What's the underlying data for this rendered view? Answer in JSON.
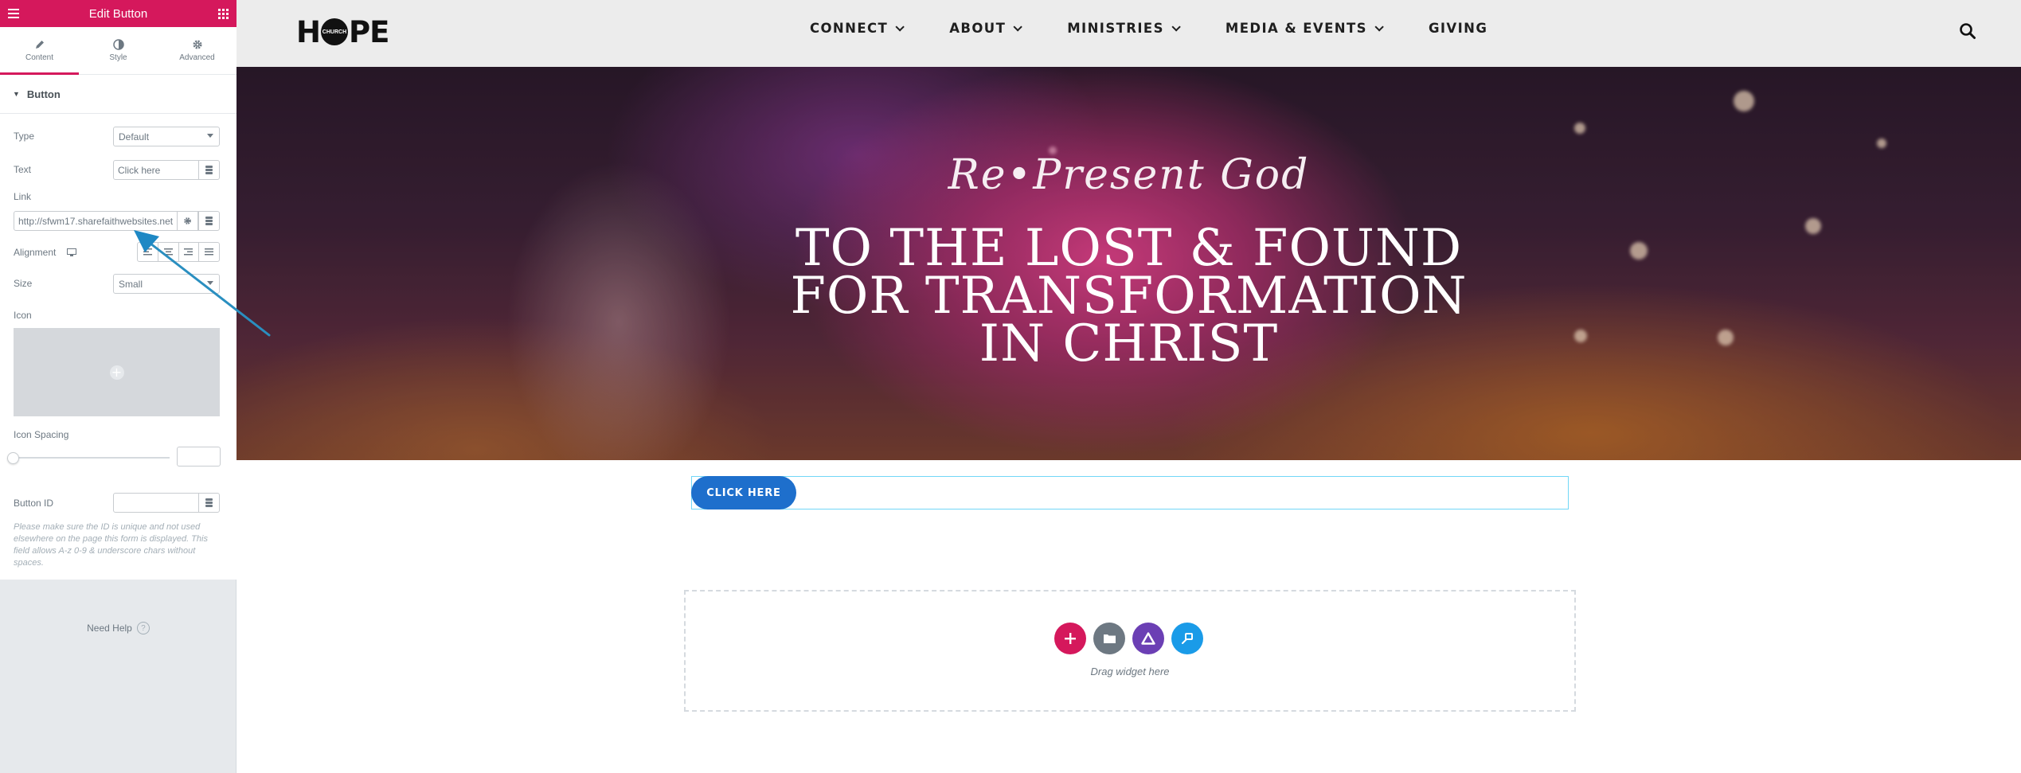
{
  "panel": {
    "title": "Edit Button",
    "tabs": [
      {
        "label": "Content",
        "icon": "pencil-icon"
      },
      {
        "label": "Style",
        "icon": "contrast-icon"
      },
      {
        "label": "Advanced",
        "icon": "gear-icon"
      }
    ],
    "section_title": "Button",
    "controls": {
      "type_label": "Type",
      "type_value": "Default",
      "text_label": "Text",
      "text_placeholder": "Click here",
      "link_label": "Link",
      "link_value": "http://sfwm17.sharefaithwebsites.net",
      "alignment_label": "Alignment",
      "size_label": "Size",
      "size_value": "Small",
      "icon_label": "Icon",
      "icon_spacing_label": "Icon Spacing",
      "button_id_label": "Button ID",
      "button_id_description": "Please make sure the ID is unique and not used elsewhere on the page this form is displayed. This field allows A-z 0-9 & underscore chars without spaces."
    },
    "need_help": "Need Help",
    "accent_color": "#d5185c"
  },
  "site": {
    "logo": {
      "letters_before": "H",
      "circle_text": "CHURCH",
      "letters_after": "PE"
    },
    "nav": [
      {
        "label": "CONNECT",
        "has_dropdown": true
      },
      {
        "label": "ABOUT",
        "has_dropdown": true
      },
      {
        "label": "MINISTRIES",
        "has_dropdown": true
      },
      {
        "label": "MEDIA & EVENTS",
        "has_dropdown": true
      },
      {
        "label": "GIVING",
        "has_dropdown": false
      }
    ],
    "hero": {
      "script_line": "Re•Present God",
      "title_lines": [
        "TO THE LOST & FOUND",
        "FOR TRANSFORMATION",
        "IN CHRIST"
      ]
    },
    "button_label": "CLICK HERE",
    "button_color": "#1e6fcc",
    "drop_area": {
      "label": "Drag widget here",
      "buttons": [
        {
          "icon": "plus-icon",
          "color": "#d5185c"
        },
        {
          "icon": "folder-icon",
          "color": "#6d7882"
        },
        {
          "icon": "triangle-icon",
          "color": "#6b3fb4"
        },
        {
          "icon": "navigator-icon",
          "color": "#1a9be8"
        }
      ]
    }
  }
}
